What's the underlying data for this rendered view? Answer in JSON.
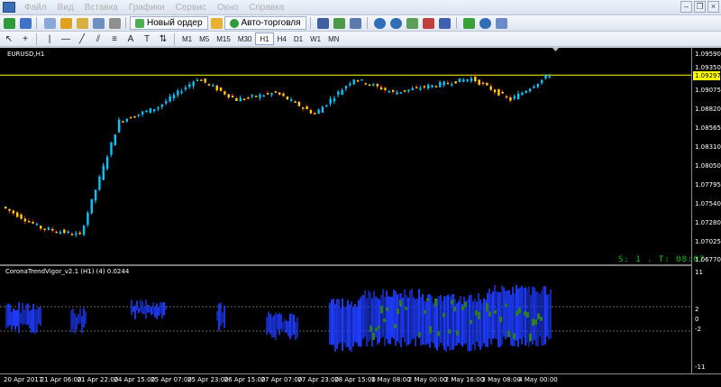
{
  "menu": {
    "items": [
      "Файл",
      "Вид",
      "Вставка",
      "Графики",
      "Сервис",
      "Окно",
      "Справка"
    ]
  },
  "toolbar": {
    "new_order_label": "Новый ордер",
    "autotrading_label": "Авто-торговля",
    "timeframes": [
      "M1",
      "M5",
      "M15",
      "M30",
      "H1",
      "H4",
      "D1",
      "W1",
      "MN"
    ],
    "active_timeframe": "H1"
  },
  "chart": {
    "symbol_label": "EURUSD,H1",
    "indicator_label": "CoronaTrendVigor_v2.1 (H1) (4) 0.0244",
    "timer_text": "S: 1 . T: 08:07",
    "current_price": "1.09297",
    "price_ticks": [
      "1.09590",
      "1.09350",
      "1.09075",
      "1.08820",
      "1.08565",
      "1.08310",
      "1.08050",
      "1.07795",
      "1.07540",
      "1.07280",
      "1.07025",
      "1.06770"
    ],
    "indicator_ticks": [
      "11",
      "2",
      "0",
      "-2",
      "-11"
    ],
    "time_labels": [
      "20 Apr 2017",
      "21 Apr 06:00",
      "21 Apr 22:00",
      "24 Apr 15:00",
      "25 Apr 07:00",
      "25 Apr 23:00",
      "26 Apr 15:00",
      "27 Apr 07:00",
      "27 Apr 23:00",
      "28 Apr 15:00",
      "1 May 08:00",
      "2 May 00:00",
      "2 May 16:00",
      "3 May 08:00",
      "4 May 00:00"
    ],
    "colors": {
      "bull": "#00c8ff",
      "bear": "#ffd700",
      "wick_bear": "#ff2020",
      "indicator_blue": "#1e3cff",
      "indicator_green": "#2e7d1e",
      "current_price_line": "#ffff00"
    }
  },
  "chart_data": {
    "type": "line",
    "x": [
      "20 Apr 2017",
      "21 Apr 06:00",
      "21 Apr 22:00",
      "24 Apr 15:00",
      "25 Apr 07:00",
      "25 Apr 23:00",
      "26 Apr 15:00",
      "27 Apr 07:00",
      "27 Apr 23:00",
      "28 Apr 15:00",
      "1 May 08:00",
      "2 May 00:00",
      "2 May 16:00",
      "3 May 08:00",
      "4 May 00:00"
    ],
    "series": [
      {
        "values": [
          1.0745,
          1.0715,
          1.0705,
          1.0865,
          1.0885,
          1.0925,
          1.0895,
          1.0905,
          1.0875,
          1.0925,
          1.0905,
          1.0915,
          1.0925,
          1.0895,
          1.093
        ]
      }
    ],
    "ylim": [
      1.0664,
      1.0968
    ],
    "grid": false
  }
}
